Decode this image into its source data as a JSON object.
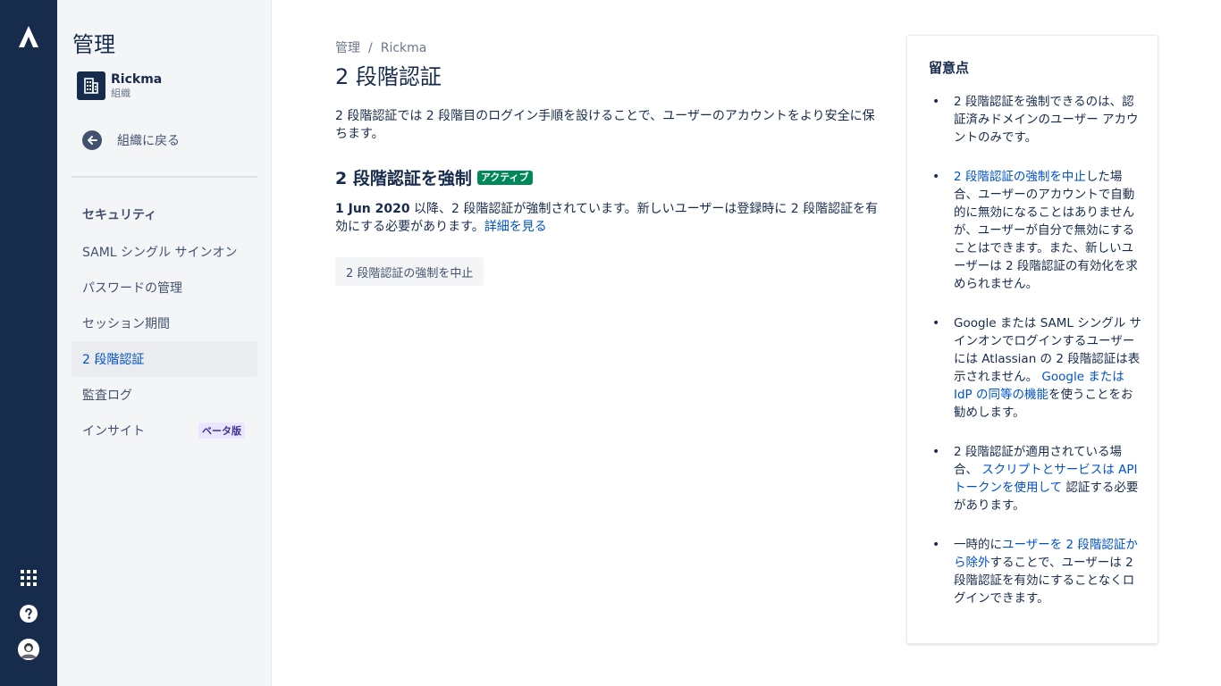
{
  "sidebar": {
    "title": "管理",
    "org": {
      "name": "Rickma",
      "subtitle": "組織"
    },
    "back_label": "組織に戻る",
    "section_title": "セキュリティ",
    "items": [
      {
        "label": "SAML シングル サインオン"
      },
      {
        "label": "パスワードの管理"
      },
      {
        "label": "セッション期間"
      },
      {
        "label": "2 段階認証"
      },
      {
        "label": "監査ログ"
      },
      {
        "label": "インサイト",
        "badge": "ベータ版"
      }
    ],
    "selected_item": "2 段階認証"
  },
  "main": {
    "breadcrumb": [
      "管理",
      "Rickma"
    ],
    "breadcrumb_separator": "/",
    "title": "2 段階認証",
    "intro": "2 段階認証では 2 段階目のログイン手順を設けることで、ユーザーのアカウントをより安全に保ちます。",
    "enforce_heading": "2 段階認証を強制",
    "status_lozenge": "アクティブ",
    "status_date": "1 Jun 2020",
    "status_text": " 以降、2 段階認証が強制されています。新しいユーザーは登録時に 2 段階認証を有効にする必要があります。",
    "learn_more_link": "詳細を見る",
    "disable_button": "2 段階認証の強制を中止"
  },
  "notes": {
    "title": "留意点",
    "items": [
      {
        "text": "2 段階認証を強制できるのは、認証済みドメインのユーザー アカウントのみです。"
      },
      {
        "link": "2 段階認証の強制を中止",
        "text": "した場合、ユーザーのアカウントで自動的に無効になることはありませんが、ユーザーが自分で無効にすることはできます。また、新しいユーザーは 2 段階認証の有効化を求められません。"
      },
      {
        "text": "Google または SAML シングル サインオンでログインするユーザーには Atlassian の 2 段階認証は表示されません。",
        "link": "Google または IdP の同等の機能",
        "text_after": "を使うことをお勧めします。"
      },
      {
        "text": "2 段階認証が適用されている場合、",
        "link": "スクリプトとサービスは API トークンを使用して",
        "text_after": "認証する必要があります。"
      },
      {
        "text": "一時的に",
        "link": "ユーザーを 2 段階認証から除外",
        "text_after": "することで、ユーザーは 2 段階認証を有効にすることなくログインできます。"
      }
    ]
  },
  "icons": {
    "logo": "atlassian-logo-icon",
    "apps": "app-switcher-icon",
    "help": "help-icon",
    "avatar": "user-avatar",
    "org": "building-icon",
    "back": "arrow-left-icon"
  },
  "colors": {
    "rail": "#172b4d",
    "sidebar": "#f4f5f7",
    "link": "#0052cc",
    "active_lozenge": "#00875a",
    "beta_badge_bg": "#eae6ff",
    "beta_badge_text": "#403294"
  }
}
